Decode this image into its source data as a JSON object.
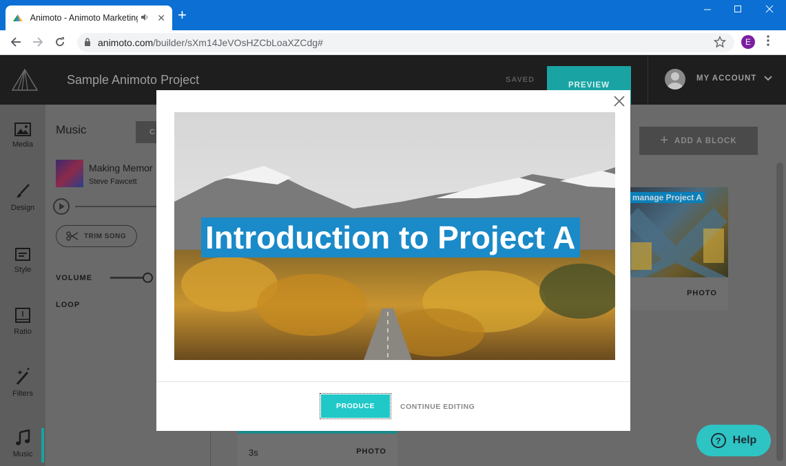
{
  "browser": {
    "tab_title": "Animoto - Animoto Marketing",
    "audio_icon": "speaker-icon",
    "close_glyph": "✕",
    "new_tab_glyph": "+",
    "url_host": "animoto.com",
    "url_path": "/builder/sXm14JeVOsHZCbLoaXZCdg#",
    "profile_initial": "E"
  },
  "header": {
    "project_title": "Sample Animoto Project",
    "saved_label": "SAVED",
    "preview_label": "PREVIEW",
    "account_label": "MY ACCOUNT"
  },
  "rail": {
    "items": [
      {
        "label": "Media",
        "icon": "image-icon"
      },
      {
        "label": "Design",
        "icon": "brush-icon"
      },
      {
        "label": "Style",
        "icon": "style-icon"
      },
      {
        "label": "Ratio",
        "icon": "ratio-icon"
      },
      {
        "label": "Filters",
        "icon": "magic-wand-icon"
      },
      {
        "label": "Music",
        "icon": "music-note-icon"
      }
    ]
  },
  "music_panel": {
    "title": "Music",
    "change_label": "C",
    "song_name": "Making Memor",
    "artist": "Steve Fawcett",
    "trim_label": "TRIM SONG",
    "volume_label": "VOLUME",
    "volume_level": 0.88,
    "loop_label": "LOOP"
  },
  "main": {
    "add_block_label": "ADD A BLOCK",
    "card_overlay_text": "manage Project A",
    "card_type": "PHOTO",
    "bottom_card_duration": "3s",
    "bottom_card_type": "PHOTO"
  },
  "modal": {
    "caption": "Introduction to Project A",
    "produce_label": "PRODUCE",
    "continue_label": "CONTINUE EDITING"
  },
  "help": {
    "label": "Help",
    "glyph": "?"
  },
  "colors": {
    "accent": "#20c8c8",
    "chrome_blue": "#0b6fd3",
    "caption_bg": "#1a8ac8"
  }
}
